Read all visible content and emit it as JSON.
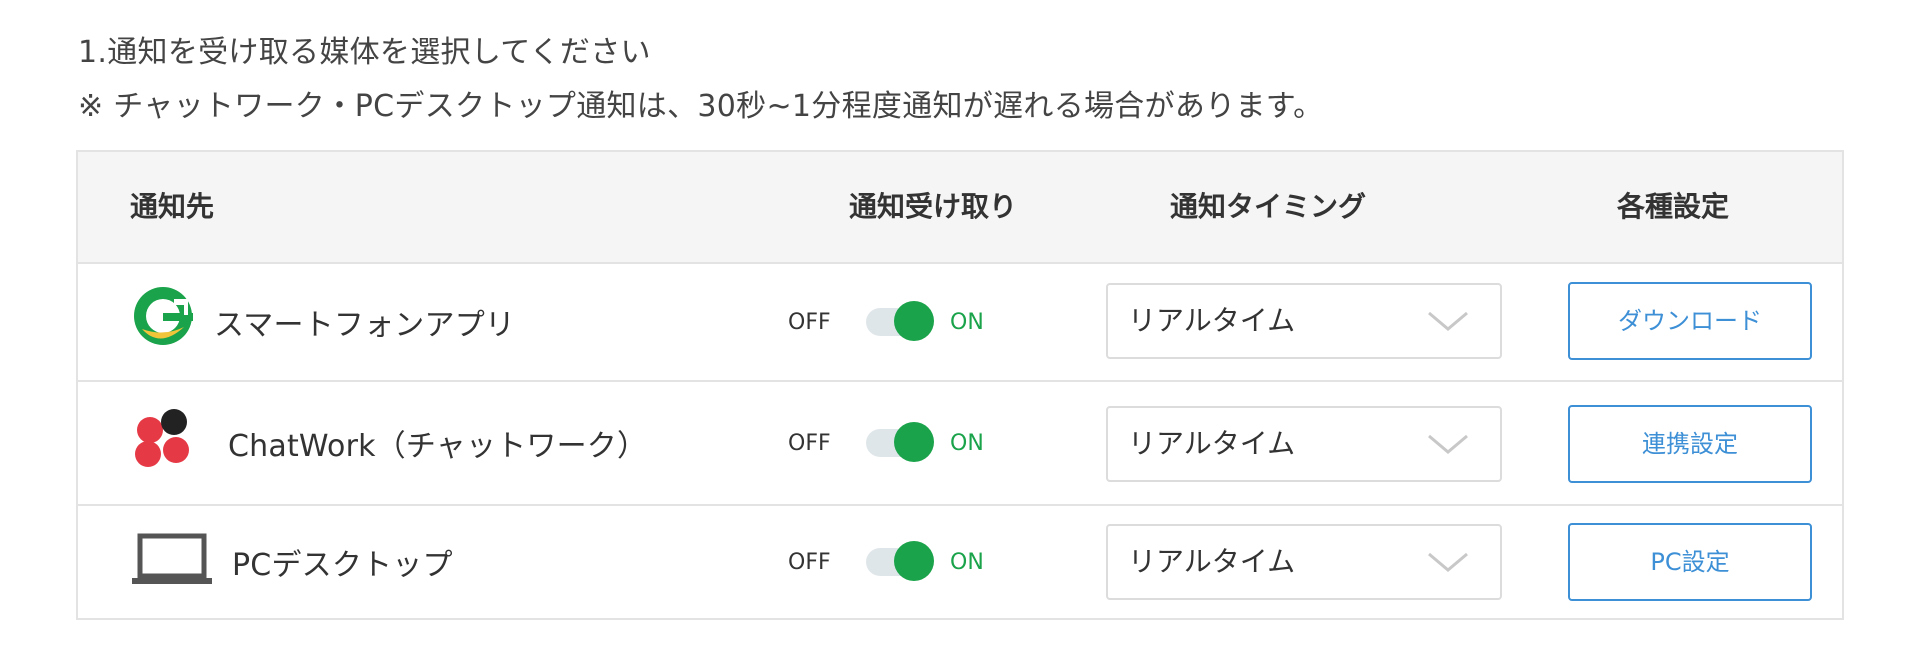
{
  "intro": {
    "line1": "1.通知を受け取る媒体を選択してください",
    "line2": "※ チャットワーク・PCデスクトップ通知は、30秒~1分程度通知が遅れる場合があります。"
  },
  "table": {
    "headers": {
      "destination": "通知先",
      "receive": "通知受け取り",
      "timing": "通知タイミング",
      "settings": "各種設定"
    },
    "rows": [
      {
        "icon": "smartphone-app-icon",
        "label": "スマートフォンアプリ",
        "off_label": "OFF",
        "on_label": "ON",
        "toggle_on": true,
        "timing": "リアルタイム",
        "button": "ダウンロード"
      },
      {
        "icon": "chatwork-icon",
        "label": "ChatWork（チャットワーク）",
        "off_label": "OFF",
        "on_label": "ON",
        "toggle_on": true,
        "timing": "リアルタイム",
        "button": "連携設定"
      },
      {
        "icon": "laptop-icon",
        "label": "PCデスクトップ",
        "off_label": "OFF",
        "on_label": "ON",
        "toggle_on": true,
        "timing": "リアルタイム",
        "button": "PC設定"
      }
    ]
  },
  "colors": {
    "accent_green": "#1aa34a",
    "button_blue": "#3d8fd6",
    "header_bg": "#f5f5f5",
    "border": "#e3e3e3"
  }
}
